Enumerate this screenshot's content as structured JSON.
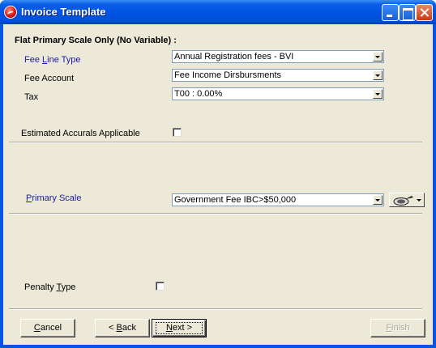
{
  "window": {
    "title": "Invoice Template"
  },
  "form": {
    "section_heading": "Flat Primary Scale Only (No Variable) :",
    "fee_line_type": {
      "label_pre": "Fee ",
      "label_mn": "L",
      "label_post": "ine Type",
      "value": "Annual Registration fees - BVI"
    },
    "fee_account": {
      "label": "Fee Account",
      "value": "Fee Income Dirsbursments"
    },
    "tax": {
      "label": "Tax",
      "value": "T00 : 0.00%"
    },
    "estimated_accruals": {
      "label": "Estimated Accurals Applicable",
      "checked": false
    },
    "primary_scale": {
      "label_mn": "P",
      "label_post": "rimary Scale",
      "value": "Government Fee IBC>$50,000"
    },
    "penalty_type": {
      "label_pre": "Penalty ",
      "label_mn": "T",
      "label_post": "ype",
      "checked": false
    }
  },
  "buttons": {
    "cancel": {
      "mn": "C",
      "rest": "ancel"
    },
    "back": {
      "prefix": "< ",
      "mn": "B",
      "rest": "ack"
    },
    "next": {
      "mn": "N",
      "rest": "ext >"
    },
    "finish": {
      "mn": "F",
      "rest": "inish"
    }
  }
}
